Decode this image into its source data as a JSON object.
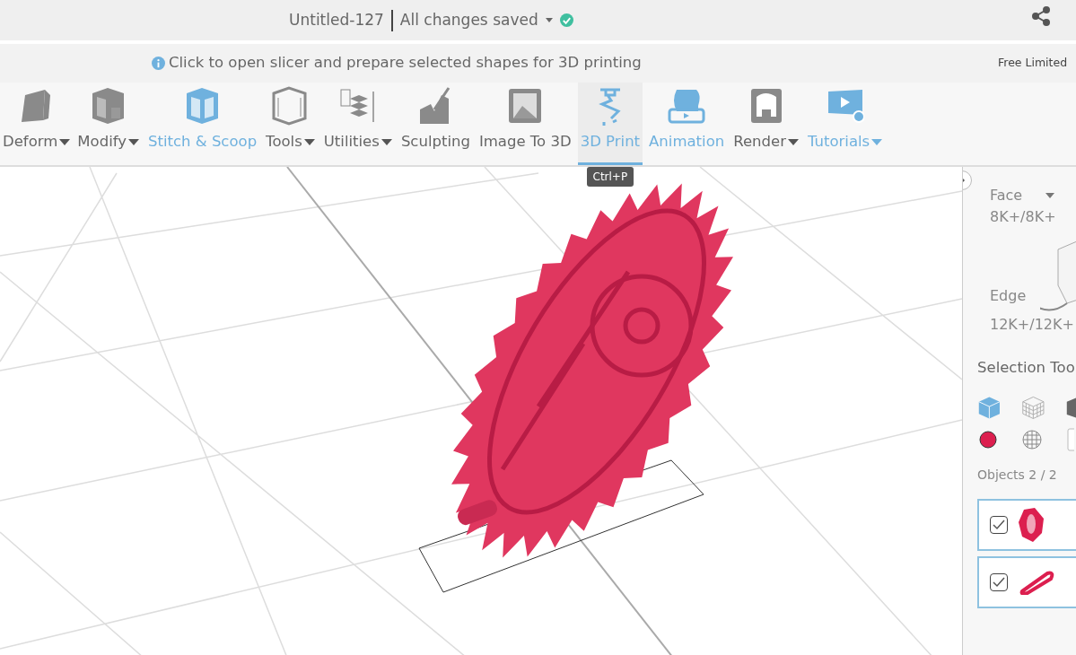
{
  "header": {
    "title": "Untitled-127",
    "save_status": "All changes saved"
  },
  "info_bar": {
    "message": "Click to open slicer and prepare selected shapes for 3D printing",
    "plan": "Free Limited"
  },
  "toolbar": [
    {
      "label": "Deform",
      "dropdown": true,
      "highlighted": false,
      "selected": false
    },
    {
      "label": "Modify",
      "dropdown": true,
      "highlighted": false,
      "selected": false
    },
    {
      "label": "Stitch & Scoop",
      "dropdown": false,
      "highlighted": true,
      "selected": false
    },
    {
      "label": "Tools",
      "dropdown": true,
      "highlighted": false,
      "selected": false
    },
    {
      "label": "Utilities",
      "dropdown": true,
      "highlighted": false,
      "selected": false
    },
    {
      "label": "Sculpting",
      "dropdown": false,
      "highlighted": false,
      "selected": false
    },
    {
      "label": "Image To 3D",
      "dropdown": false,
      "highlighted": false,
      "selected": false
    },
    {
      "label": "3D Print",
      "dropdown": false,
      "highlighted": true,
      "selected": true,
      "tooltip": "Ctrl+P"
    },
    {
      "label": "Animation",
      "dropdown": false,
      "highlighted": true,
      "selected": false
    },
    {
      "label": "Render",
      "dropdown": true,
      "highlighted": false,
      "selected": false
    },
    {
      "label": "Tutorials",
      "dropdown": true,
      "highlighted": true,
      "selected": false
    }
  ],
  "panel": {
    "mode": "Face",
    "face_count": "8K+/8K+",
    "edge_label": "Edge",
    "edge_count": "12K+/12K+",
    "section_title": "Selection Too",
    "objects_label": "Objects 2 / 2",
    "objects": [
      {
        "checked": true,
        "selected": true
      },
      {
        "checked": true,
        "selected": true
      }
    ]
  }
}
